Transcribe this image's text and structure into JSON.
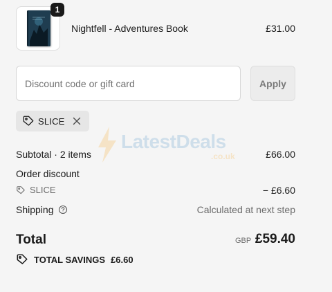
{
  "product": {
    "name": "Nightfell - Adventures Book",
    "price": "£31.00",
    "quantity": "1"
  },
  "discount": {
    "placeholder": "Discount code or gift card",
    "value": "",
    "apply_label": "Apply",
    "applied_code": "SLICE"
  },
  "watermark": {
    "brand": "LatestDeals",
    "domain": ".co.uk"
  },
  "summary": {
    "subtotal_label": "Subtotal · 2 items",
    "subtotal_value": "£66.00",
    "order_discount_label": "Order discount",
    "discount_code": "SLICE",
    "discount_value": "− £6.60",
    "shipping_label": "Shipping",
    "shipping_value": "Calculated at next step"
  },
  "total": {
    "label": "Total",
    "currency": "GBP",
    "amount": "£59.40"
  },
  "savings": {
    "label": "TOTAL SAVINGS",
    "amount": "£6.60"
  },
  "colors": {
    "background": "#f5f5f5",
    "text": "#1a1a1a",
    "muted_text": "#6b6b6b",
    "badge": "#1a1a1a",
    "chip": "#e6e6e6"
  },
  "icons": [
    "tag-icon",
    "close-icon",
    "help-icon",
    "savings-tag-icon",
    "watermark-bolt-icon"
  ]
}
